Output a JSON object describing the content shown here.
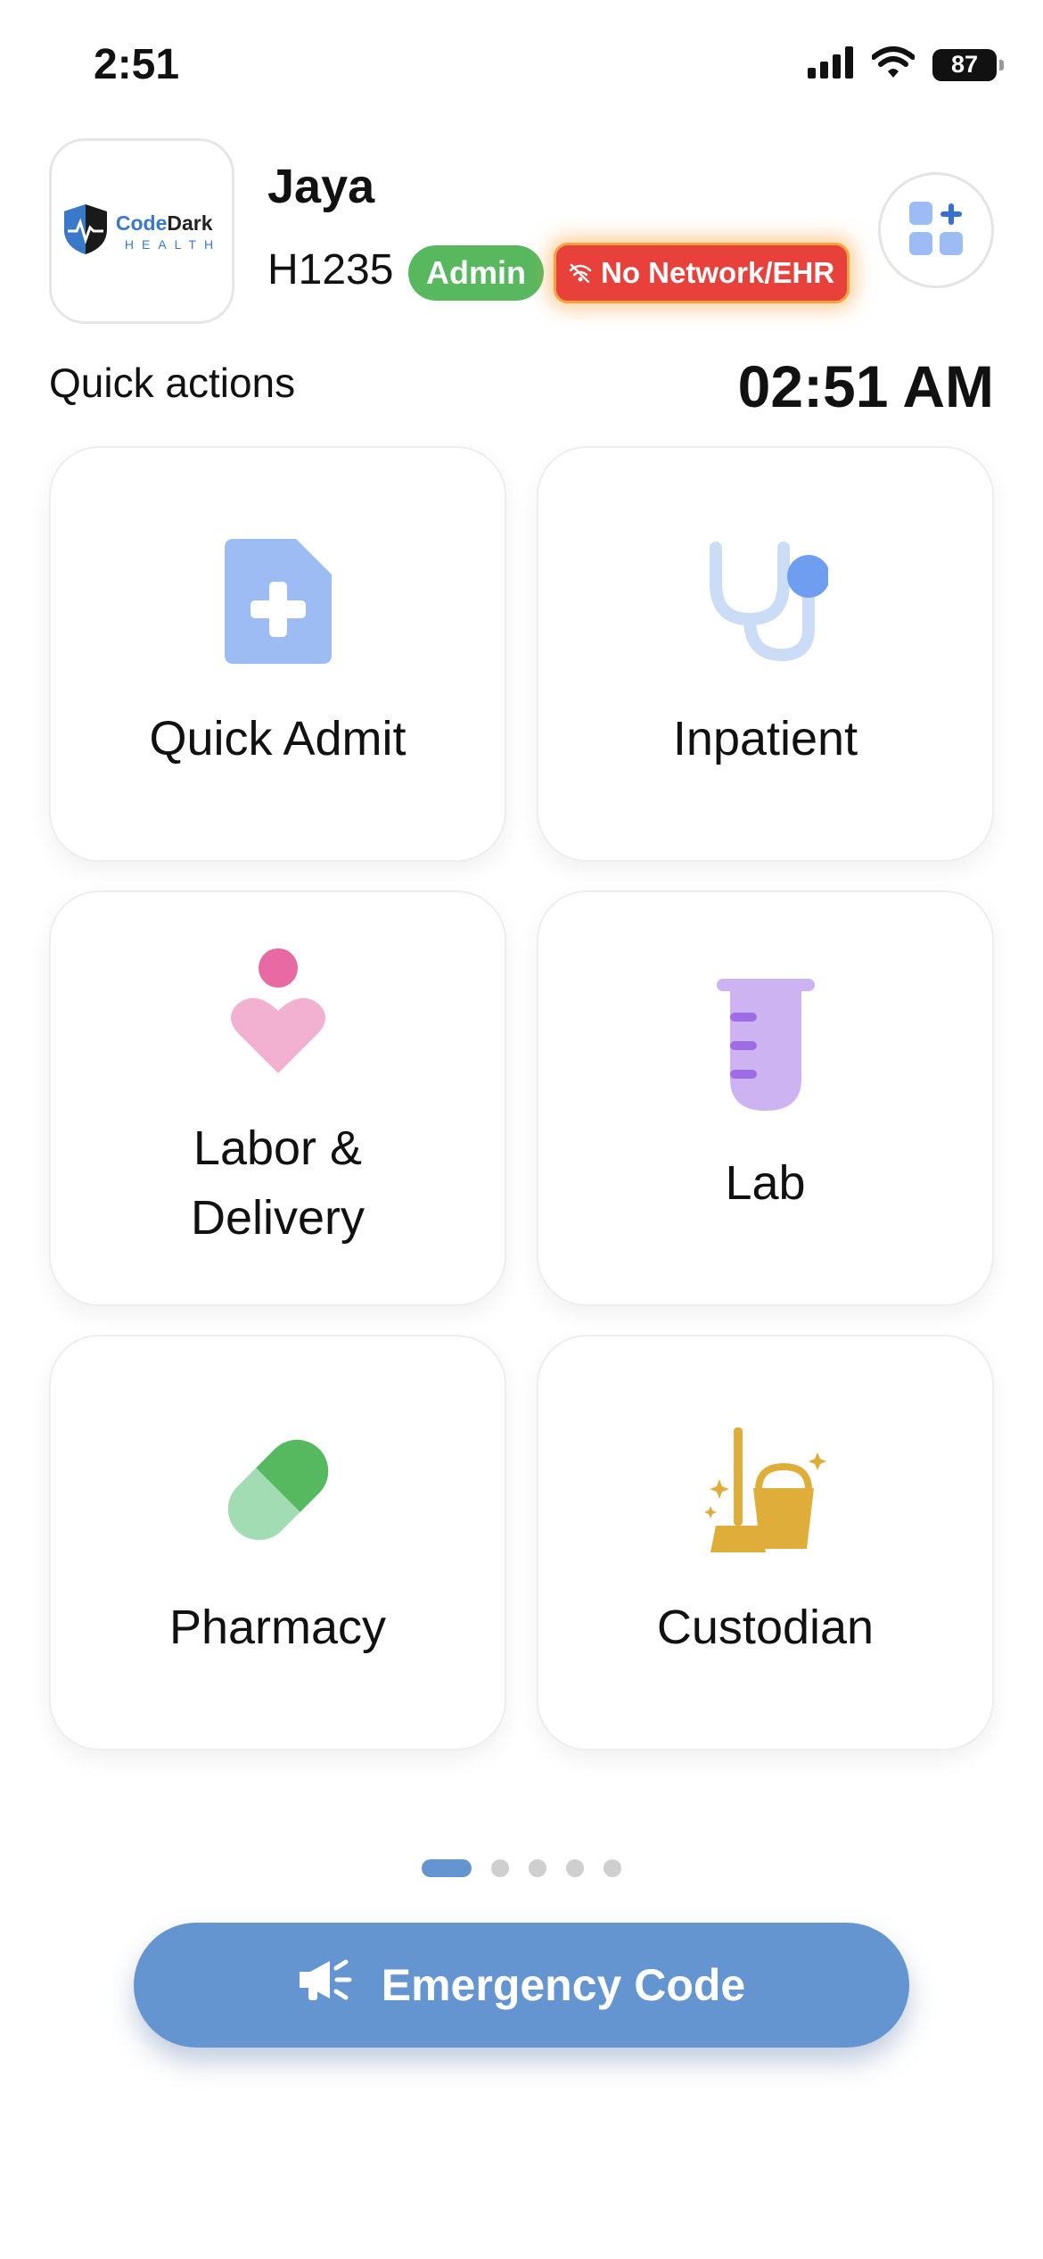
{
  "status_bar": {
    "time": "2:51",
    "battery": "87"
  },
  "logo": {
    "brand_part1": "Code",
    "brand_part2": "Dark",
    "subtitle": "HEALTH"
  },
  "user": {
    "name": "Jaya",
    "id": "H1235",
    "role": "Admin",
    "network_status": "No Network/EHR"
  },
  "section": {
    "title": "Quick actions",
    "clock": "02:51 AM"
  },
  "actions": [
    {
      "label": "Quick Admit",
      "icon": "document-plus-icon"
    },
    {
      "label": "Inpatient",
      "icon": "stethoscope-icon"
    },
    {
      "label": "Labor & Delivery",
      "icon": "mother-heart-icon"
    },
    {
      "label": "Lab",
      "icon": "test-tube-icon"
    },
    {
      "label": "Pharmacy",
      "icon": "pill-capsule-icon"
    },
    {
      "label": "Custodian",
      "icon": "broom-bucket-icon"
    }
  ],
  "pager": {
    "page_count": 5,
    "current_page": 1
  },
  "emergency": {
    "label": "Emergency Code"
  },
  "colors": {
    "accent": "#6495d1",
    "admin_badge": "#58b85e",
    "network_badge": "#e8403a",
    "admit_icon": "#9cbcf3",
    "inpatient_icon": "#6f9ef0",
    "labor_icon": "#e76aa2",
    "lab_icon": "#cdb3f2",
    "pharmacy_icon": "#56b95f",
    "custodian_icon": "#dfad3a"
  }
}
